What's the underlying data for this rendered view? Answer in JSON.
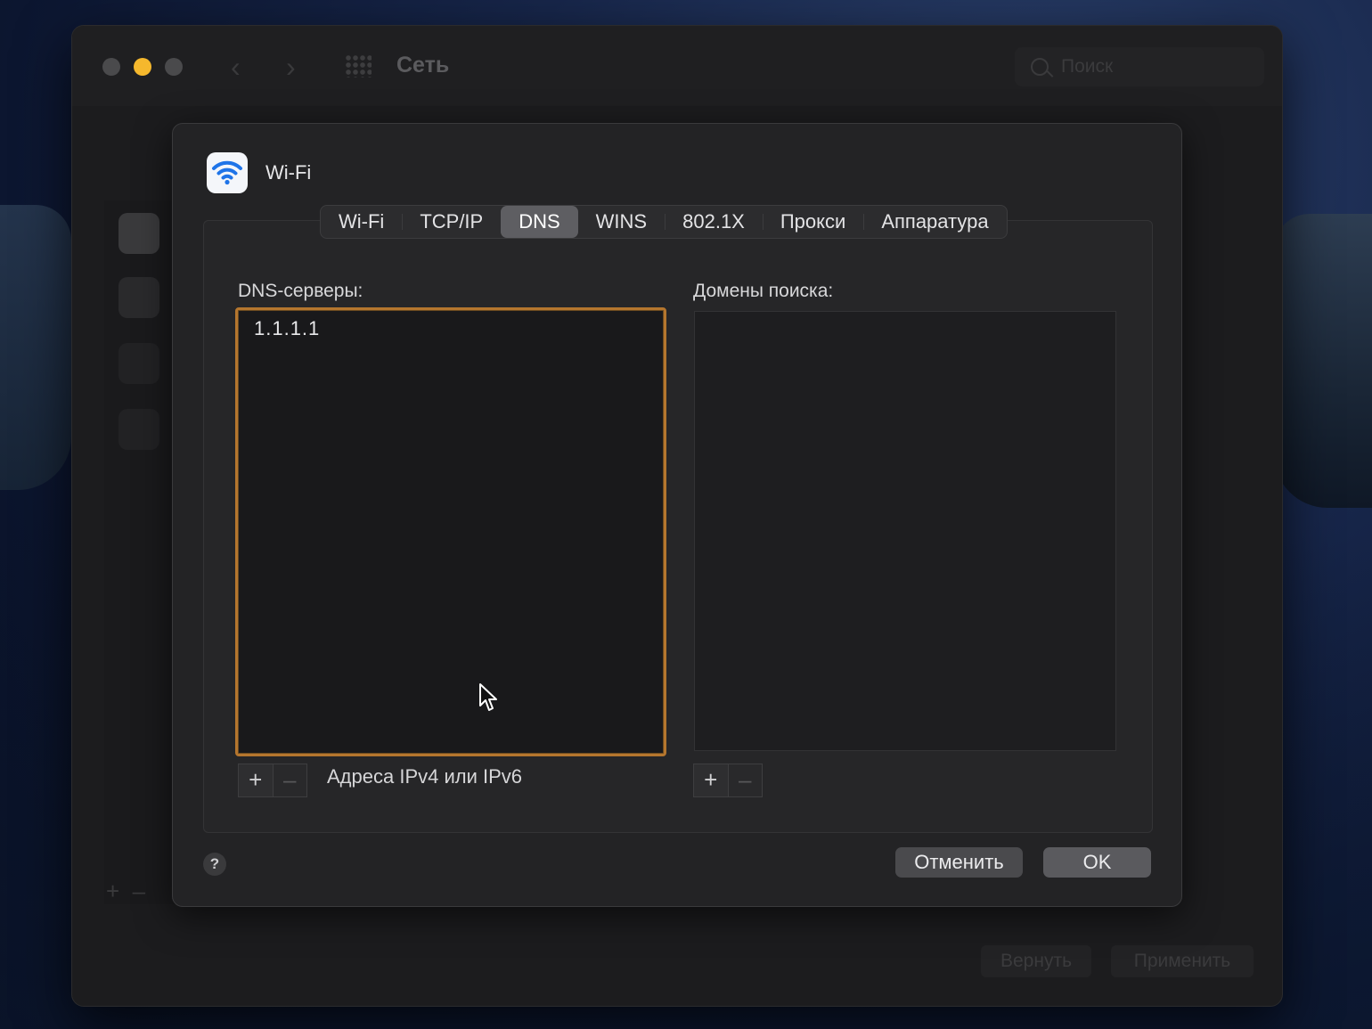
{
  "window": {
    "title": "Сеть",
    "search_placeholder": "Поиск",
    "back_glyph": "‹",
    "forward_glyph": "›",
    "revert_label": "Вернуть",
    "apply_label": "Применить",
    "bg_add": "+",
    "bg_remove": "–"
  },
  "sheet": {
    "title": "Wi-Fi",
    "tabs": [
      {
        "label": "Wi-Fi"
      },
      {
        "label": "TCP/IP"
      },
      {
        "label": "DNS"
      },
      {
        "label": "WINS"
      },
      {
        "label": "802.1X"
      },
      {
        "label": "Прокси"
      },
      {
        "label": "Аппаратура"
      }
    ],
    "active_tab": "DNS",
    "dns_servers_label": "DNS-серверы:",
    "dns_servers": [
      "1.1.1.1"
    ],
    "search_domains_label": "Домены поиска:",
    "search_domains": [],
    "add_glyph": "+",
    "remove_glyph": "–",
    "hint": "Адреса IPv4 или IPv6",
    "help_glyph": "?",
    "cancel_label": "Отменить",
    "ok_label": "OK"
  },
  "colors": {
    "accent_focus": "#b5762e",
    "minimize": "#f5b82d",
    "wifi_blue": "#1f74e8"
  },
  "icons": [
    "wifi-icon",
    "search-icon",
    "help-icon",
    "cursor-icon"
  ]
}
